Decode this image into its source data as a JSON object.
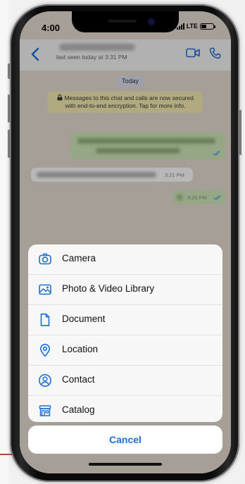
{
  "status_bar": {
    "time": "4:00",
    "network": "LTE"
  },
  "chat_header": {
    "last_seen": "last seen today at 3:31 PM",
    "back_icon": "chevron-left-icon",
    "video_icon": "video-camera-icon",
    "call_icon": "phone-icon",
    "accent": "#1e6fd6"
  },
  "chat": {
    "date_label": "Today",
    "encryption_notice": "Messages to this chat and calls are now secured with end-to-end encryption. Tap for more info.",
    "messages": [
      {
        "direction": "outgoing",
        "time": ""
      },
      {
        "direction": "incoming",
        "time": "3:21 PM"
      },
      {
        "direction": "outgoing",
        "time": "3:25 PM"
      }
    ]
  },
  "action_sheet": {
    "items": [
      {
        "label": "Camera",
        "icon": "camera-icon"
      },
      {
        "label": "Photo & Video Library",
        "icon": "photo-library-icon"
      },
      {
        "label": "Document",
        "icon": "document-icon"
      },
      {
        "label": "Location",
        "icon": "location-pin-icon"
      },
      {
        "label": "Contact",
        "icon": "contact-icon"
      },
      {
        "label": "Catalog",
        "icon": "catalog-store-icon"
      }
    ],
    "cancel_label": "Cancel"
  }
}
